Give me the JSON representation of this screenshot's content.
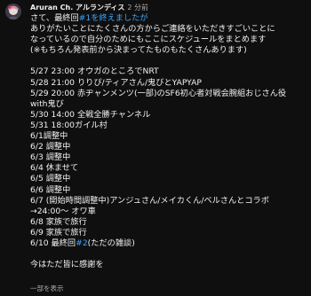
{
  "comment": {
    "author": "Aruran Ch. アルランディス",
    "timestamp": "2 分前",
    "intro": {
      "prefix": "さて、最終回",
      "tag": "#1を終えましたが"
    },
    "paragraph": [
      "ありがたいことにたくさんの方からご連絡をいただきすごいことに",
      "なっているので自分のためにもここにスケジュールをまとめます",
      "(※もちろん発表前から決まってたものもたくさんあります)"
    ],
    "schedule": [
      "5/27 23:00 オウガのところでNRT",
      "5/28 21:00 りりぴ/ティアさん/鬼びとYAPYAP",
      "5/29 20:00 赤ヂャンメンツ(一部)のSF6初心者対戦会腕組おじさん役",
      "with鬼び",
      "5/30 14:00 全戦全勝チャンネル",
      "5/31 18:00ガイル村",
      "6/1調整中",
      "6/2 調整中",
      "6/3 調整中",
      "6/4 休ませて",
      "6/5 調整中",
      "6/6 調整中",
      "6/7 (開始時間調整中)アンジュさん/メイカくん/ベルさんとコラボ",
      "→24:00～ オワ車",
      "6/8 家族で旅行",
      "6/9 家族で旅行"
    ],
    "last_item": {
      "prefix": "6/10 最終回",
      "tag": "#2",
      "suffix": "(ただの雑談)"
    },
    "closing": "今はただ皆に感謝を",
    "read_more": "一部を表示"
  }
}
